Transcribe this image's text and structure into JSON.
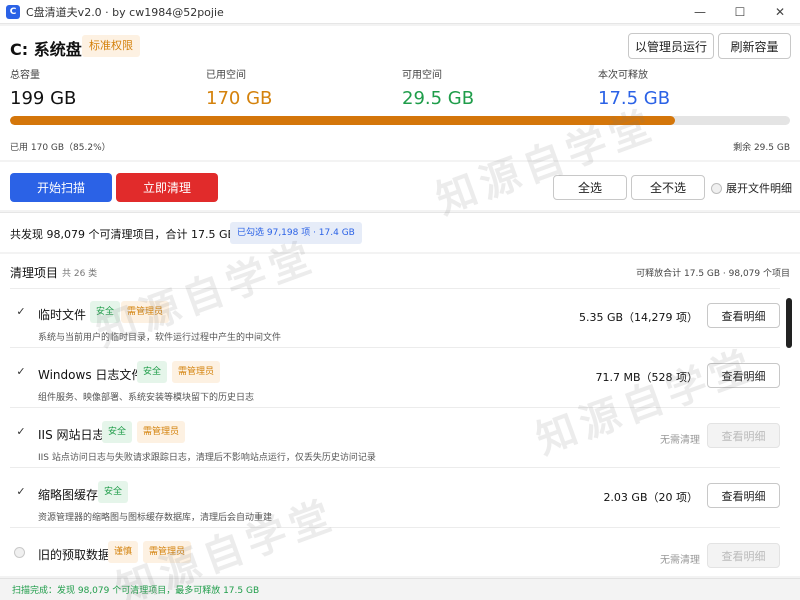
{
  "window": {
    "title": "C盘清道夫v2.0 · by cw1984@52pojie",
    "icon": "C",
    "minimize": "—",
    "maximize": "☐",
    "close": "✕"
  },
  "drive": {
    "title": "C: 系统盘",
    "permission_badge": "标准权限",
    "run_as_admin_label": "以管理员运行",
    "refresh_label": "刷新容量"
  },
  "stats": {
    "total_label": "总容量",
    "total_value": "199 GB",
    "used_label": "已用空间",
    "used_value": "170 GB",
    "free_label": "可用空间",
    "free_value": "29.5 GB",
    "release_label": "本次可释放",
    "release_value": "17.5 GB"
  },
  "usage": {
    "used_percent": 85.2,
    "used_text": "已用 170 GB（85.2%）",
    "remain_text": "剩余 29.5 GB"
  },
  "actions": {
    "scan_label": "开始扫描",
    "clean_label": "立即清理",
    "select_all_label": "全选",
    "select_none_label": "全不选",
    "expand_label": "展开文件明细"
  },
  "summary": {
    "found_text": "共发现 98,079 个可清理项目，合计 17.5 GB",
    "selected_text": "已勾选 97,198 项 · 17.4 GB"
  },
  "list": {
    "title": "清理项目",
    "count": "共 26 类",
    "total": "可释放合计 17.5 GB · 98,079 个项目",
    "detail_label": "查看明细",
    "items": [
      {
        "checked": true,
        "check_mark": "✓",
        "name": "临时文件",
        "tags": [
          "安全",
          "需管理员"
        ],
        "desc": "系统与当前用户的临时目录，软件运行过程中产生的中间文件",
        "size": "5.35 GB（14,279 项）",
        "has_detail": true
      },
      {
        "checked": true,
        "check_mark": "✓",
        "name": "Windows 日志文件",
        "tags": [
          "安全",
          "需管理员"
        ],
        "desc": "组件服务、映像部署、系统安装等模块留下的历史日志",
        "size": "71.7 MB（528 项）",
        "has_detail": true
      },
      {
        "checked": true,
        "check_mark": "✓",
        "name": "IIS 网站日志",
        "tags": [
          "安全",
          "需管理员"
        ],
        "desc": "IIS 站点访问日志与失败请求跟踪日志，清理后不影响站点运行，仅丢失历史访问记录",
        "nothing": "无需清理",
        "has_detail": false
      },
      {
        "checked": true,
        "check_mark": "✓",
        "name": "缩略图缓存",
        "tags": [
          "安全"
        ],
        "desc": "资源管理器的缩略图与图标缓存数据库，清理后会自动重建",
        "size": "2.03 GB（20 项）",
        "has_detail": true
      },
      {
        "checked": false,
        "name": "旧的预取数据",
        "tags": [
          "谨慎",
          "需管理员"
        ],
        "nothing": "无需清理",
        "has_detail": false
      }
    ]
  },
  "status": {
    "text": "扫描完成：发现 98,079 个可清理项目，最多可释放 17.5 GB"
  },
  "watermark": "知源自学堂",
  "colors": {
    "primary": "#2b62e6",
    "danger": "#e12b2b",
    "used": "#d4820c",
    "free": "#1f9d4a"
  }
}
